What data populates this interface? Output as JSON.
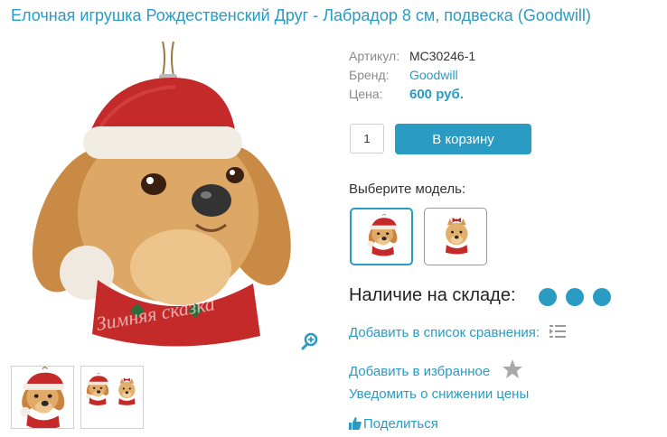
{
  "product": {
    "title": "Елочная игрушка Рождественский Друг - Лабрадор 8 см, подвеска (Goodwill)"
  },
  "gallery": {
    "watermark": "Зимняя сказка"
  },
  "properties": {
    "article_label": "Артикул:",
    "article_value": "MC30246-1",
    "brand_label": "Бренд:",
    "brand_value": "Goodwill",
    "price_label": "Цена:",
    "price_value": "600 руб."
  },
  "purchase": {
    "quantity": "1",
    "cart_button": "В корзину"
  },
  "models": {
    "label": "Выберите модель:"
  },
  "stock": {
    "label": "Наличие на складе:",
    "level_dots": 3
  },
  "actions": {
    "compare": "Добавить в список сравнения:",
    "favorite": "Добавить в избранное",
    "notify": "Уведомить о снижении цены",
    "share": "Поделиться"
  },
  "colors": {
    "accent": "#2a9bc2",
    "cap_red": "#c42a2a",
    "fur": "#d9a25c"
  },
  "icons": [
    "zoom-icon",
    "compare-list-icon",
    "star-icon",
    "thumbs-up-icon"
  ]
}
